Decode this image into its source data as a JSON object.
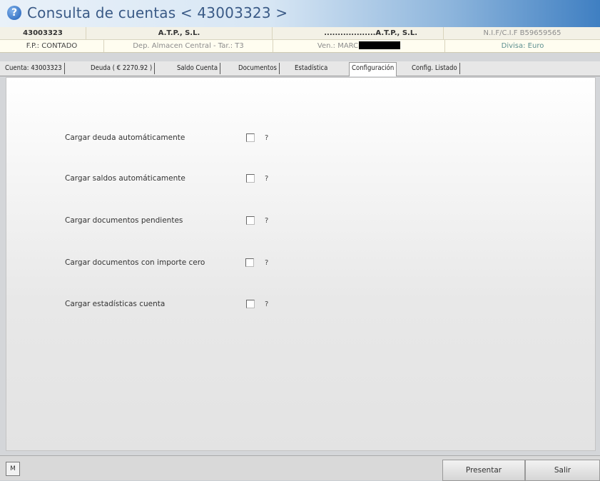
{
  "window": {
    "title": "Consulta de cuentas   < 43003323 >",
    "help_icon_glyph": "?"
  },
  "header": {
    "account_code": "43003323",
    "company_short": "A.T.P., S.L.",
    "company_dotted": "...................A.T.P., S.L.",
    "nif": "N.I.F/C.I.F B59659565"
  },
  "subheader": {
    "payment": "F.P.: CONTADO",
    "warehouse": "Dep. Almacen Central - Tar.: T3",
    "seller": "Ven.: MARC",
    "currency": "Divisa: Euro"
  },
  "tabs": [
    {
      "label": "Cuenta: 43003323"
    },
    {
      "label": "Deuda ( € 2270.92 )"
    },
    {
      "label": "Saldo Cuenta"
    },
    {
      "label": "Documentos"
    },
    {
      "label": "Estadística"
    },
    {
      "label": "Configuración"
    },
    {
      "label": "Config. Listado"
    }
  ],
  "options": [
    {
      "label": "Cargar deuda automáticamente",
      "checked": false,
      "help": "?"
    },
    {
      "label": "Cargar saldos automáticamente",
      "checked": false,
      "help": "?"
    },
    {
      "label": "Cargar documentos pendientes",
      "checked": false,
      "help": "?"
    },
    {
      "label": "Cargar documentos con importe cero",
      "checked": false,
      "help": "?"
    },
    {
      "label": "Cargar estadísticas cuenta",
      "checked": false,
      "help": "?"
    }
  ],
  "footer": {
    "m_label": "M",
    "present_label": "Presentar",
    "exit_label": "Salir"
  },
  "colors": {
    "title_blue": "#3a5a86",
    "title_gradient_end": "#3f7fc2"
  }
}
